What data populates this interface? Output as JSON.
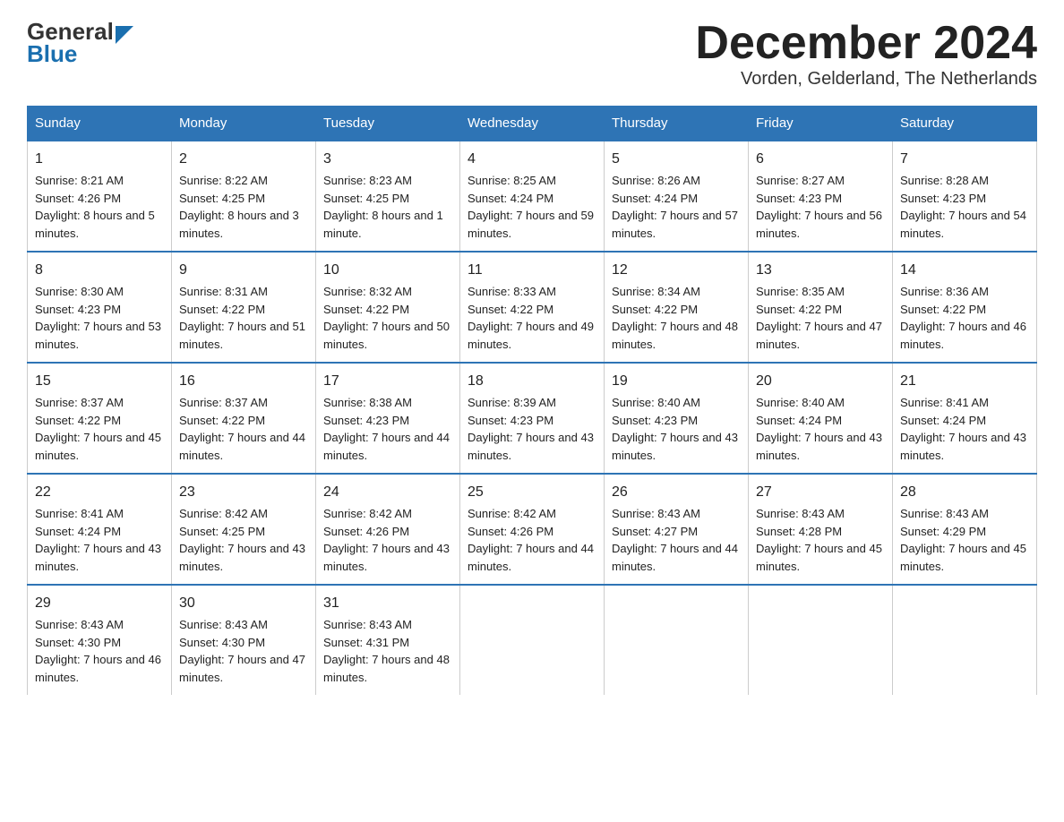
{
  "header": {
    "logo_general": "General",
    "logo_blue": "Blue",
    "title": "December 2024",
    "subtitle": "Vorden, Gelderland, The Netherlands"
  },
  "days_of_week": [
    "Sunday",
    "Monday",
    "Tuesday",
    "Wednesday",
    "Thursday",
    "Friday",
    "Saturday"
  ],
  "weeks": [
    {
      "days": [
        {
          "number": "1",
          "sunrise": "8:21 AM",
          "sunset": "4:26 PM",
          "daylight": "8 hours and 5 minutes."
        },
        {
          "number": "2",
          "sunrise": "8:22 AM",
          "sunset": "4:25 PM",
          "daylight": "8 hours and 3 minutes."
        },
        {
          "number": "3",
          "sunrise": "8:23 AM",
          "sunset": "4:25 PM",
          "daylight": "8 hours and 1 minute."
        },
        {
          "number": "4",
          "sunrise": "8:25 AM",
          "sunset": "4:24 PM",
          "daylight": "7 hours and 59 minutes."
        },
        {
          "number": "5",
          "sunrise": "8:26 AM",
          "sunset": "4:24 PM",
          "daylight": "7 hours and 57 minutes."
        },
        {
          "number": "6",
          "sunrise": "8:27 AM",
          "sunset": "4:23 PM",
          "daylight": "7 hours and 56 minutes."
        },
        {
          "number": "7",
          "sunrise": "8:28 AM",
          "sunset": "4:23 PM",
          "daylight": "7 hours and 54 minutes."
        }
      ]
    },
    {
      "days": [
        {
          "number": "8",
          "sunrise": "8:30 AM",
          "sunset": "4:23 PM",
          "daylight": "7 hours and 53 minutes."
        },
        {
          "number": "9",
          "sunrise": "8:31 AM",
          "sunset": "4:22 PM",
          "daylight": "7 hours and 51 minutes."
        },
        {
          "number": "10",
          "sunrise": "8:32 AM",
          "sunset": "4:22 PM",
          "daylight": "7 hours and 50 minutes."
        },
        {
          "number": "11",
          "sunrise": "8:33 AM",
          "sunset": "4:22 PM",
          "daylight": "7 hours and 49 minutes."
        },
        {
          "number": "12",
          "sunrise": "8:34 AM",
          "sunset": "4:22 PM",
          "daylight": "7 hours and 48 minutes."
        },
        {
          "number": "13",
          "sunrise": "8:35 AM",
          "sunset": "4:22 PM",
          "daylight": "7 hours and 47 minutes."
        },
        {
          "number": "14",
          "sunrise": "8:36 AM",
          "sunset": "4:22 PM",
          "daylight": "7 hours and 46 minutes."
        }
      ]
    },
    {
      "days": [
        {
          "number": "15",
          "sunrise": "8:37 AM",
          "sunset": "4:22 PM",
          "daylight": "7 hours and 45 minutes."
        },
        {
          "number": "16",
          "sunrise": "8:37 AM",
          "sunset": "4:22 PM",
          "daylight": "7 hours and 44 minutes."
        },
        {
          "number": "17",
          "sunrise": "8:38 AM",
          "sunset": "4:23 PM",
          "daylight": "7 hours and 44 minutes."
        },
        {
          "number": "18",
          "sunrise": "8:39 AM",
          "sunset": "4:23 PM",
          "daylight": "7 hours and 43 minutes."
        },
        {
          "number": "19",
          "sunrise": "8:40 AM",
          "sunset": "4:23 PM",
          "daylight": "7 hours and 43 minutes."
        },
        {
          "number": "20",
          "sunrise": "8:40 AM",
          "sunset": "4:24 PM",
          "daylight": "7 hours and 43 minutes."
        },
        {
          "number": "21",
          "sunrise": "8:41 AM",
          "sunset": "4:24 PM",
          "daylight": "7 hours and 43 minutes."
        }
      ]
    },
    {
      "days": [
        {
          "number": "22",
          "sunrise": "8:41 AM",
          "sunset": "4:24 PM",
          "daylight": "7 hours and 43 minutes."
        },
        {
          "number": "23",
          "sunrise": "8:42 AM",
          "sunset": "4:25 PM",
          "daylight": "7 hours and 43 minutes."
        },
        {
          "number": "24",
          "sunrise": "8:42 AM",
          "sunset": "4:26 PM",
          "daylight": "7 hours and 43 minutes."
        },
        {
          "number": "25",
          "sunrise": "8:42 AM",
          "sunset": "4:26 PM",
          "daylight": "7 hours and 44 minutes."
        },
        {
          "number": "26",
          "sunrise": "8:43 AM",
          "sunset": "4:27 PM",
          "daylight": "7 hours and 44 minutes."
        },
        {
          "number": "27",
          "sunrise": "8:43 AM",
          "sunset": "4:28 PM",
          "daylight": "7 hours and 45 minutes."
        },
        {
          "number": "28",
          "sunrise": "8:43 AM",
          "sunset": "4:29 PM",
          "daylight": "7 hours and 45 minutes."
        }
      ]
    },
    {
      "days": [
        {
          "number": "29",
          "sunrise": "8:43 AM",
          "sunset": "4:30 PM",
          "daylight": "7 hours and 46 minutes."
        },
        {
          "number": "30",
          "sunrise": "8:43 AM",
          "sunset": "4:30 PM",
          "daylight": "7 hours and 47 minutes."
        },
        {
          "number": "31",
          "sunrise": "8:43 AM",
          "sunset": "4:31 PM",
          "daylight": "7 hours and 48 minutes."
        },
        null,
        null,
        null,
        null
      ]
    }
  ],
  "labels": {
    "sunrise": "Sunrise:",
    "sunset": "Sunset:",
    "daylight": "Daylight:"
  }
}
